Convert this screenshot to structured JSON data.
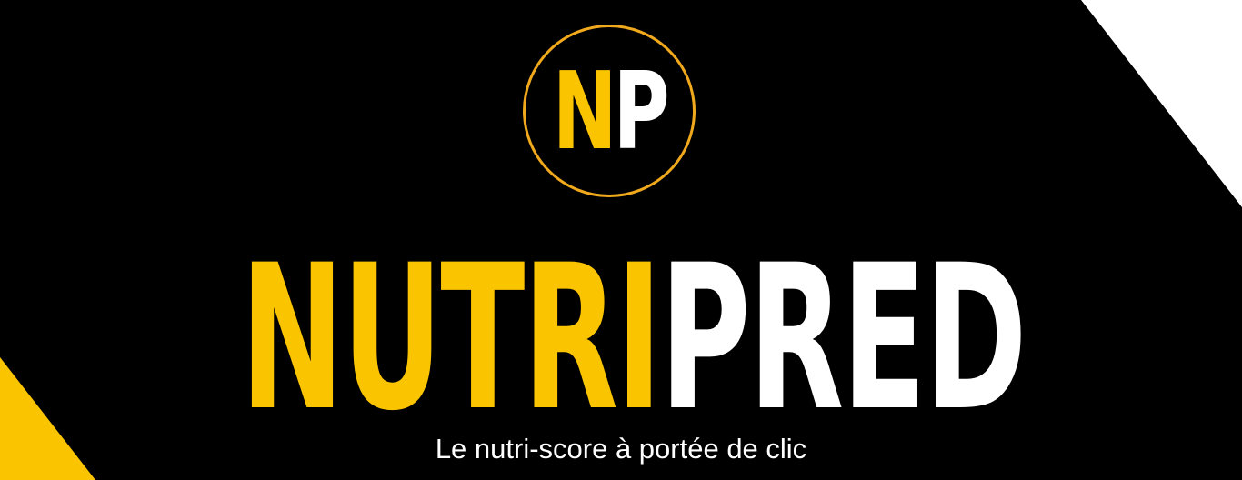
{
  "brand": {
    "logo_letter_1": "N",
    "logo_letter_2": "P",
    "title_part_1": "NUTRI",
    "title_part_2": "PRED",
    "tagline": "Le nutri-score à portée de clic"
  },
  "colors": {
    "background": "#000000",
    "accent_yellow": "#fbc400",
    "logo_ring": "#f0a81c",
    "text_white": "#ffffff"
  }
}
